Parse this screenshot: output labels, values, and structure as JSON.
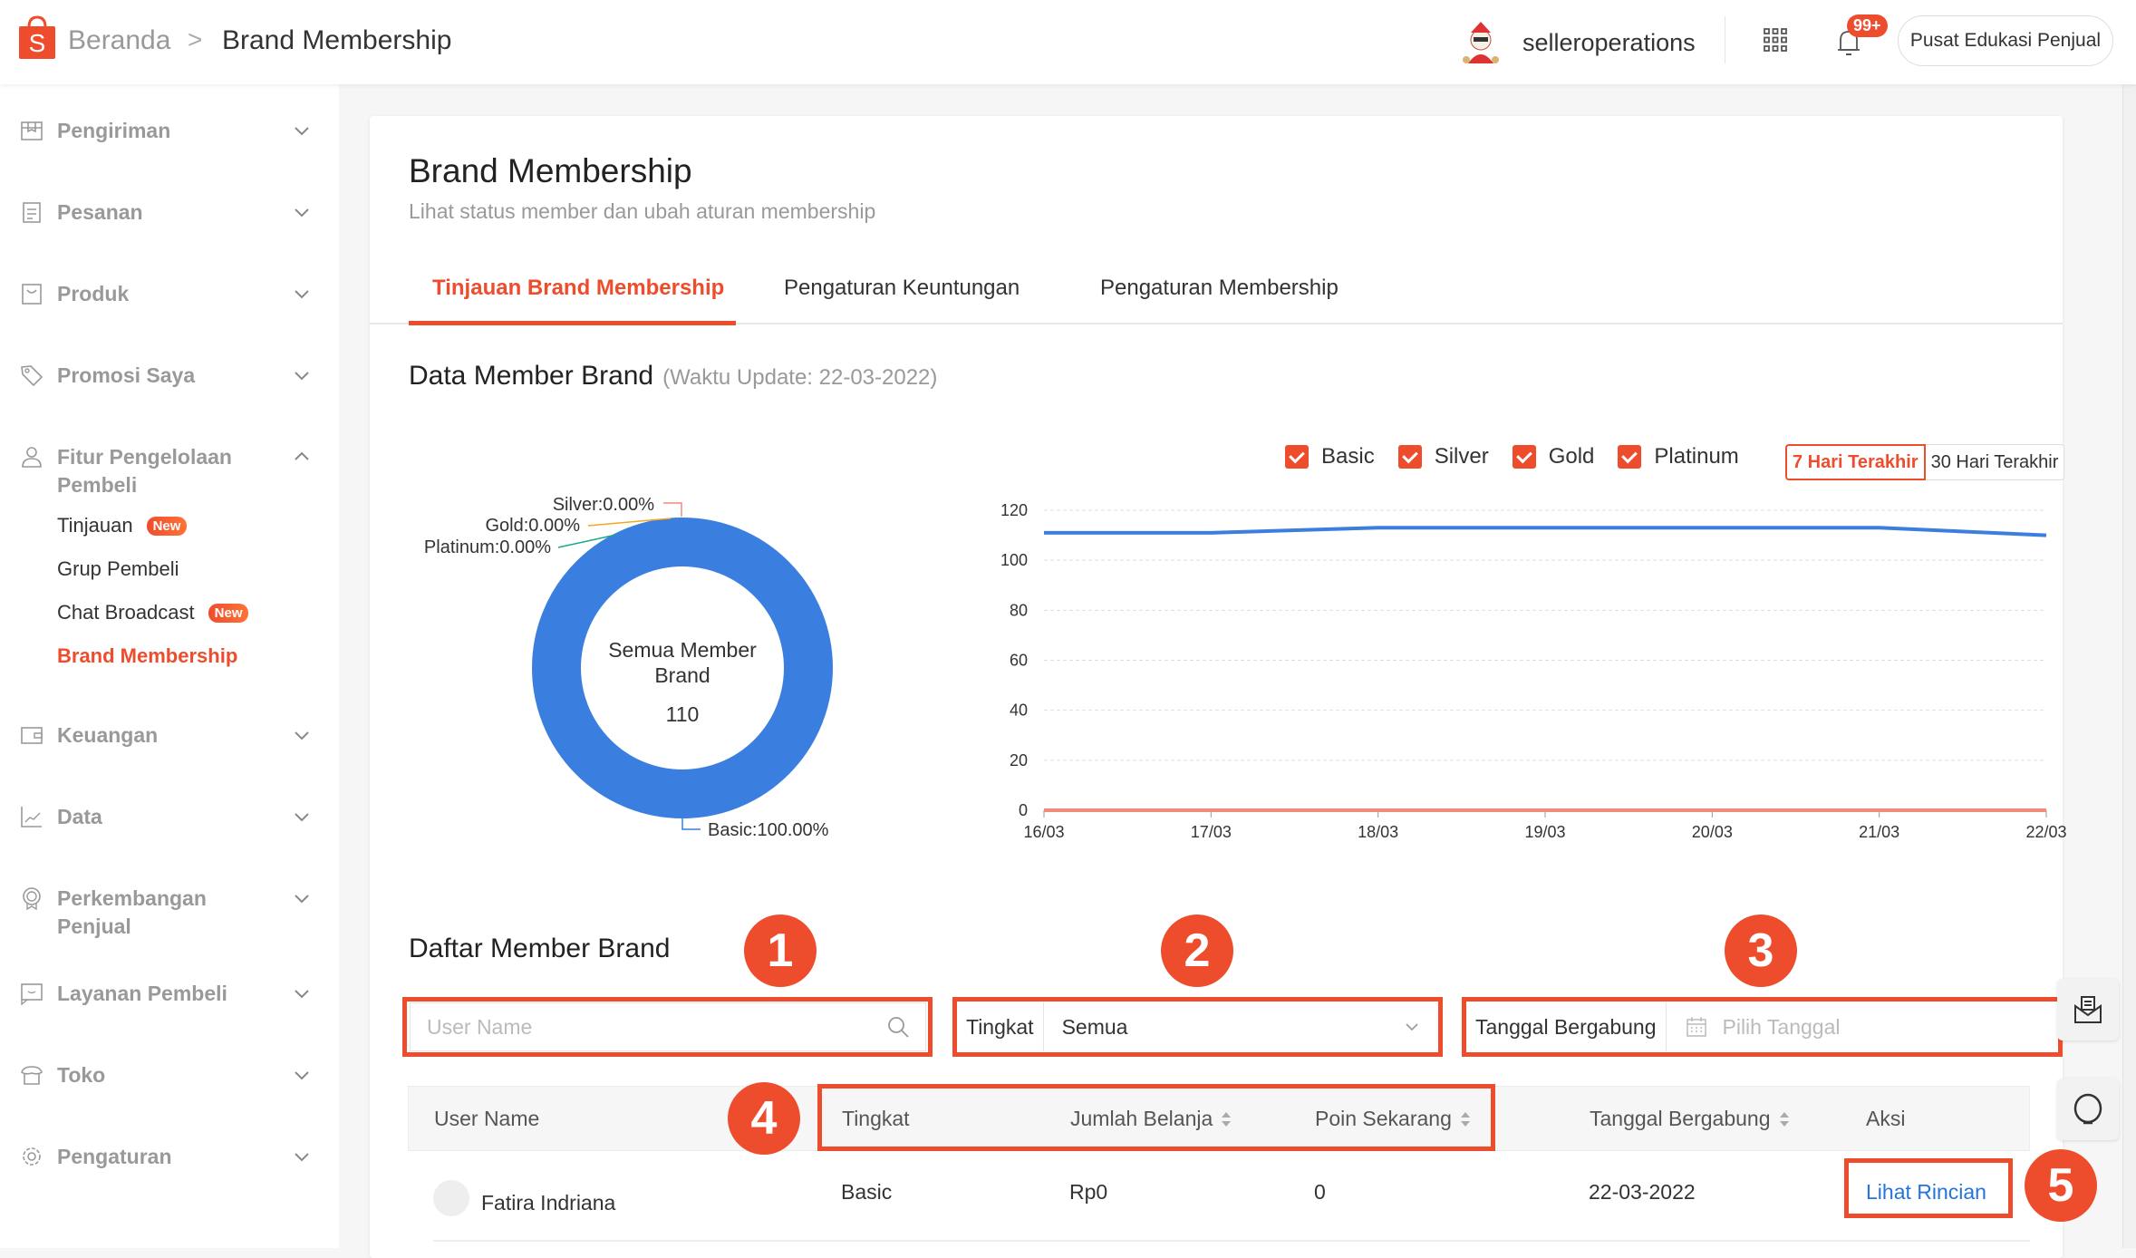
{
  "header": {
    "breadcrumb_home": "Beranda",
    "breadcrumb_separator": ">",
    "breadcrumb_current": "Brand Membership",
    "username": "selleroperations",
    "notification_count": "99+",
    "education_button": "Pusat Edukasi Penjual"
  },
  "sidebar": {
    "items": [
      {
        "label": "Pengiriman",
        "icon": "box-icon",
        "expanded": false
      },
      {
        "label": "Pesanan",
        "icon": "clipboard-icon",
        "expanded": false
      },
      {
        "label": "Produk",
        "icon": "bag-icon",
        "expanded": false
      },
      {
        "label": "Promosi Saya",
        "icon": "tag-icon",
        "expanded": false
      },
      {
        "label": "Fitur Pengelolaan Pembeli",
        "icon": "users-icon",
        "expanded": true
      },
      {
        "label": "Keuangan",
        "icon": "wallet-icon",
        "expanded": false
      },
      {
        "label": "Data",
        "icon": "chart-icon",
        "expanded": false
      },
      {
        "label": "Perkembangan Penjual",
        "icon": "medal-icon",
        "expanded": false
      },
      {
        "label": "Layanan Pembeli",
        "icon": "chat-icon",
        "expanded": false
      },
      {
        "label": "Toko",
        "icon": "store-icon",
        "expanded": false
      },
      {
        "label": "Pengaturan",
        "icon": "gear-icon",
        "expanded": false
      }
    ],
    "subitems": [
      {
        "label": "Tinjauan",
        "badge": "New"
      },
      {
        "label": "Grup Pembeli",
        "badge": null
      },
      {
        "label": "Chat Broadcast",
        "badge": "New"
      },
      {
        "label": "Brand Membership",
        "badge": null,
        "active": true
      }
    ]
  },
  "page": {
    "title": "Brand Membership",
    "subtitle": "Lihat status member dan ubah aturan membership",
    "tabs": [
      {
        "label": "Tinjauan Brand Membership",
        "active": true
      },
      {
        "label": "Pengaturan Keuntungan",
        "active": false
      },
      {
        "label": "Pengaturan Membership",
        "active": false
      }
    ],
    "data_section_title": "Data Member Brand",
    "data_section_note": "(Waktu Update: 22-03-2022)",
    "list_section_title": "Daftar Member Brand"
  },
  "legend": {
    "items": [
      {
        "label": "Basic",
        "checked": true
      },
      {
        "label": "Silver",
        "checked": true
      },
      {
        "label": "Gold",
        "checked": true
      },
      {
        "label": "Platinum",
        "checked": true
      }
    ],
    "ranges": [
      {
        "label": "7 Hari Terakhir",
        "active": true
      },
      {
        "label": "30 Hari Terakhir",
        "active": false
      }
    ]
  },
  "chart_data": [
    {
      "type": "pie",
      "title": "",
      "center_label": "Semua Member Brand",
      "center_value": "110",
      "slices": [
        {
          "name": "Basic",
          "value": 100.0,
          "label": "Basic:100.00%",
          "color": "#3a7fe0"
        },
        {
          "name": "Silver",
          "value": 0.0,
          "label": "Silver:0.00%",
          "color": "#f08a7a"
        },
        {
          "name": "Gold",
          "value": 0.0,
          "label": "Gold:0.00%",
          "color": "#f5a623"
        },
        {
          "name": "Platinum",
          "value": 0.0,
          "label": "Platinum:0.00%",
          "color": "#1aa58c"
        }
      ]
    },
    {
      "type": "line",
      "title": "",
      "xlabel": "",
      "ylabel": "",
      "x": [
        "16/03",
        "17/03",
        "18/03",
        "19/03",
        "20/03",
        "21/03",
        "22/03"
      ],
      "ylim": [
        0,
        120
      ],
      "yticks": [
        0,
        20,
        40,
        60,
        80,
        100,
        120
      ],
      "grid": true,
      "legend_position": "top-right",
      "series": [
        {
          "name": "Basic",
          "color": "#3a7fe0",
          "values": [
            111,
            111,
            113,
            113,
            113,
            113,
            110
          ]
        },
        {
          "name": "Silver",
          "color": "#f08a7a",
          "values": [
            0,
            0,
            0,
            0,
            0,
            0,
            0
          ]
        },
        {
          "name": "Gold",
          "color": "#f5a623",
          "values": [
            0,
            0,
            0,
            0,
            0,
            0,
            0
          ]
        },
        {
          "name": "Platinum",
          "color": "#1aa58c",
          "values": [
            0,
            0,
            0,
            0,
            0,
            0,
            0
          ]
        }
      ]
    }
  ],
  "filters": {
    "search_placeholder": "User Name",
    "tier_label": "Tingkat",
    "tier_value": "Semua",
    "date_label": "Tanggal Bergabung",
    "date_placeholder": "Pilih Tanggal"
  },
  "table": {
    "columns": [
      "User Name",
      "Tingkat",
      "Jumlah Belanja",
      "Poin Sekarang",
      "Tanggal Bergabung",
      "Aksi"
    ],
    "rows": [
      {
        "user_name": "Fatira Indriana",
        "tier": "Basic",
        "spend": "Rp0",
        "points": "0",
        "joined": "22-03-2022",
        "action": "Lihat Rincian"
      }
    ]
  },
  "annotations": [
    "1",
    "2",
    "3",
    "4",
    "5"
  ],
  "colors": {
    "accent": "#ee4d2d",
    "link": "#2673dd",
    "basic": "#3a7fe0"
  }
}
